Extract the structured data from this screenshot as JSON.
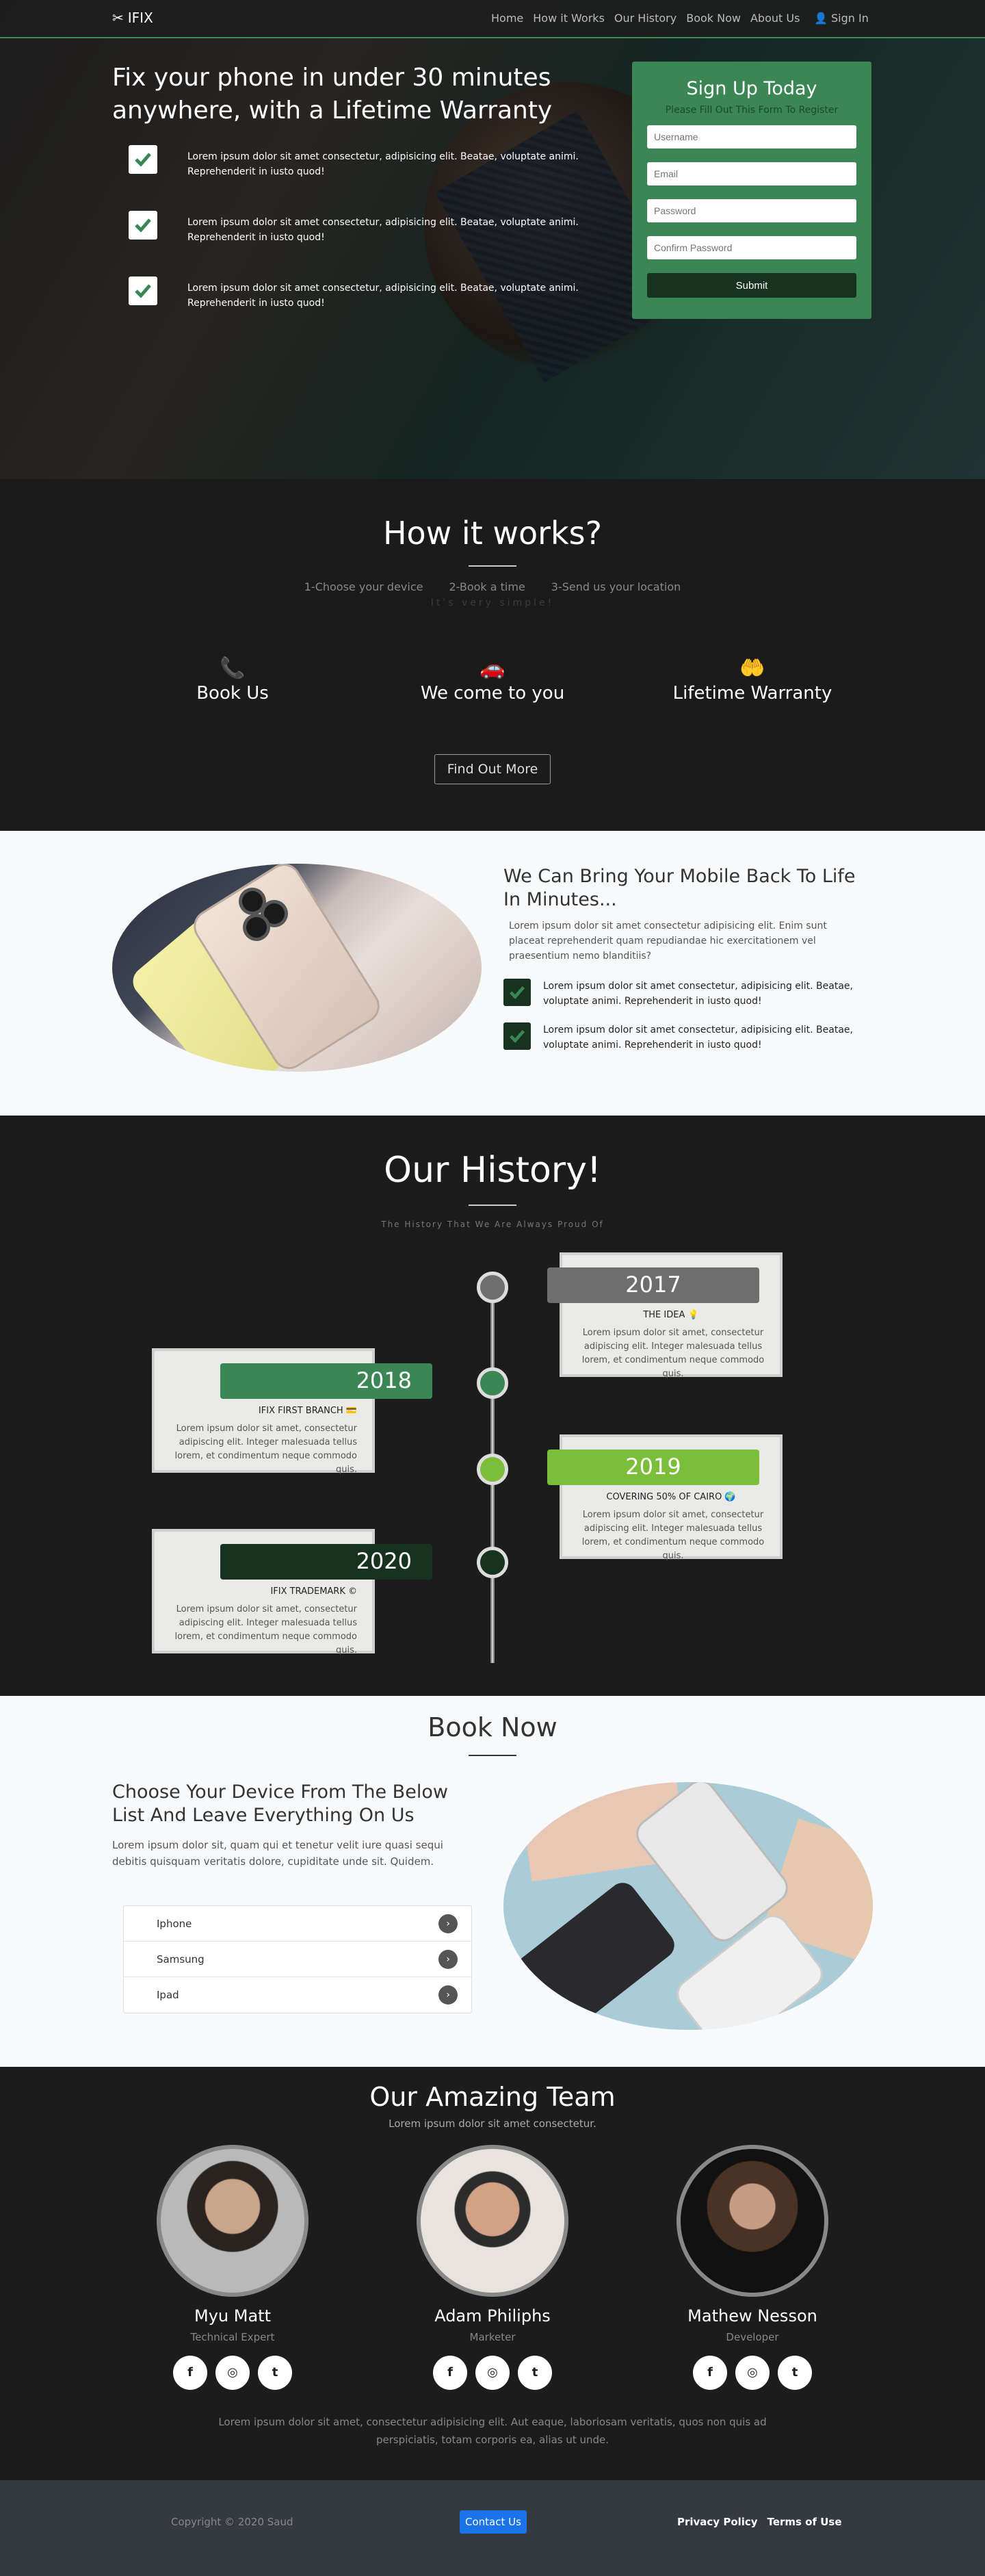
{
  "nav": {
    "brand": "IFIX",
    "items": [
      "Home",
      "How it Works",
      "Our History",
      "Book Now",
      "About Us"
    ],
    "signin": "Sign In"
  },
  "hero": {
    "title": "Fix your phone in under 30 minutes anywhere, with a Lifetime Warranty",
    "features": [
      "Lorem ipsum dolor sit amet consectetur, adipisicing elit. Beatae, voluptate animi. Reprehenderit in iusto quod!",
      "Lorem ipsum dolor sit amet consectetur, adipisicing elit. Beatae, voluptate animi. Reprehenderit in iusto quod!",
      "Lorem ipsum dolor sit amet consectetur, adipisicing elit. Beatae, voluptate animi. Reprehenderit in iusto quod!"
    ]
  },
  "signup": {
    "title": "Sign Up Today",
    "subtitle": "Please Fill Out This Form To Register",
    "username": "Username",
    "email": "Email",
    "password": "Password",
    "confirm": "Confirm Password",
    "submit": "Submit"
  },
  "how": {
    "title": "How it works?",
    "steps": [
      "1-Choose your device",
      "2-Book a time",
      "3-Send us your location"
    ],
    "simple": "It's very simple!",
    "cols": [
      {
        "icon": "phone-icon",
        "label": "Book Us"
      },
      {
        "icon": "car-icon",
        "label": "We come to you"
      },
      {
        "icon": "hands-icon",
        "label": "Lifetime Warranty"
      }
    ],
    "button": "Find Out More"
  },
  "bring": {
    "title": "We Can Bring Your Mobile Back To Life In Minutes...",
    "lead": "Lorem ipsum dolor sit amet consectetur adipisicing elit. Enim sunt placeat reprehenderit quam repudiandae hic exercitationem vel praesentium nemo blanditiis?",
    "features": [
      "Lorem ipsum dolor sit amet consectetur, adipisicing elit. Beatae, voluptate animi. Reprehenderit in iusto quod!",
      "Lorem ipsum dolor sit amet consectetur, adipisicing elit. Beatae, voluptate animi. Reprehenderit in iusto quod!"
    ]
  },
  "history": {
    "title": "Our History!",
    "subtitle": "The History That We Are Always Proud Of",
    "events": [
      {
        "year": "2017",
        "title": "THE IDEA 💡",
        "text": "Lorem ipsum dolor sit amet, consectetur adipiscing elit. Integer malesuada tellus lorem, et condimentum neque commodo quis.",
        "color": "#6e6e6e"
      },
      {
        "year": "2018",
        "title": "IFIX FIRST BRANCH 💳",
        "text": "Lorem ipsum dolor sit amet, consectetur adipiscing elit. Integer malesuada tellus lorem, et condimentum neque commodo quis.",
        "color": "#3a8654"
      },
      {
        "year": "2019",
        "title": "COVERING 50% OF CAIRO 🌍",
        "text": "Lorem ipsum dolor sit amet, consectetur adipiscing elit. Integer malesuada tellus lorem, et condimentum neque commodo quis.",
        "color": "#7cbd3a"
      },
      {
        "year": "2020",
        "title": "IFIX TRADEMARK ©",
        "text": "Lorem ipsum dolor sit amet, consectetur adipiscing elit. Integer malesuada tellus lorem, et condimentum neque commodo quis.",
        "color": "#17321f"
      }
    ]
  },
  "book": {
    "title": "Book Now",
    "heading": "Choose Your Device From The Below List And Leave Everything On Us",
    "lead": "Lorem ipsum dolor sit, quam qui et tenetur velit iure quasi sequi debitis quisquam veritatis dolore, cupiditate unde sit. Quidem.",
    "devices": [
      "Iphone",
      "Samsung",
      "Ipad"
    ]
  },
  "team": {
    "title": "Our Amazing Team",
    "subtitle": "Lorem ipsum dolor sit amet consectetur.",
    "members": [
      {
        "name": "Myu Matt",
        "role": "Technical Expert"
      },
      {
        "name": "Adam Philiphs",
        "role": "Marketer"
      },
      {
        "name": "Mathew Nesson",
        "role": "Developer"
      }
    ],
    "footer": "Lorem ipsum dolor sit amet, consectetur adipisicing elit. Aut eaque, laboriosam veritatis, quos non quis ad perspiciatis, totam corporis ea, alias ut unde."
  },
  "footer": {
    "copyright": "Copyright © 2020 Saud",
    "contact": "Contact Us",
    "privacy": "Privacy Policy",
    "terms": "Terms of Use"
  }
}
